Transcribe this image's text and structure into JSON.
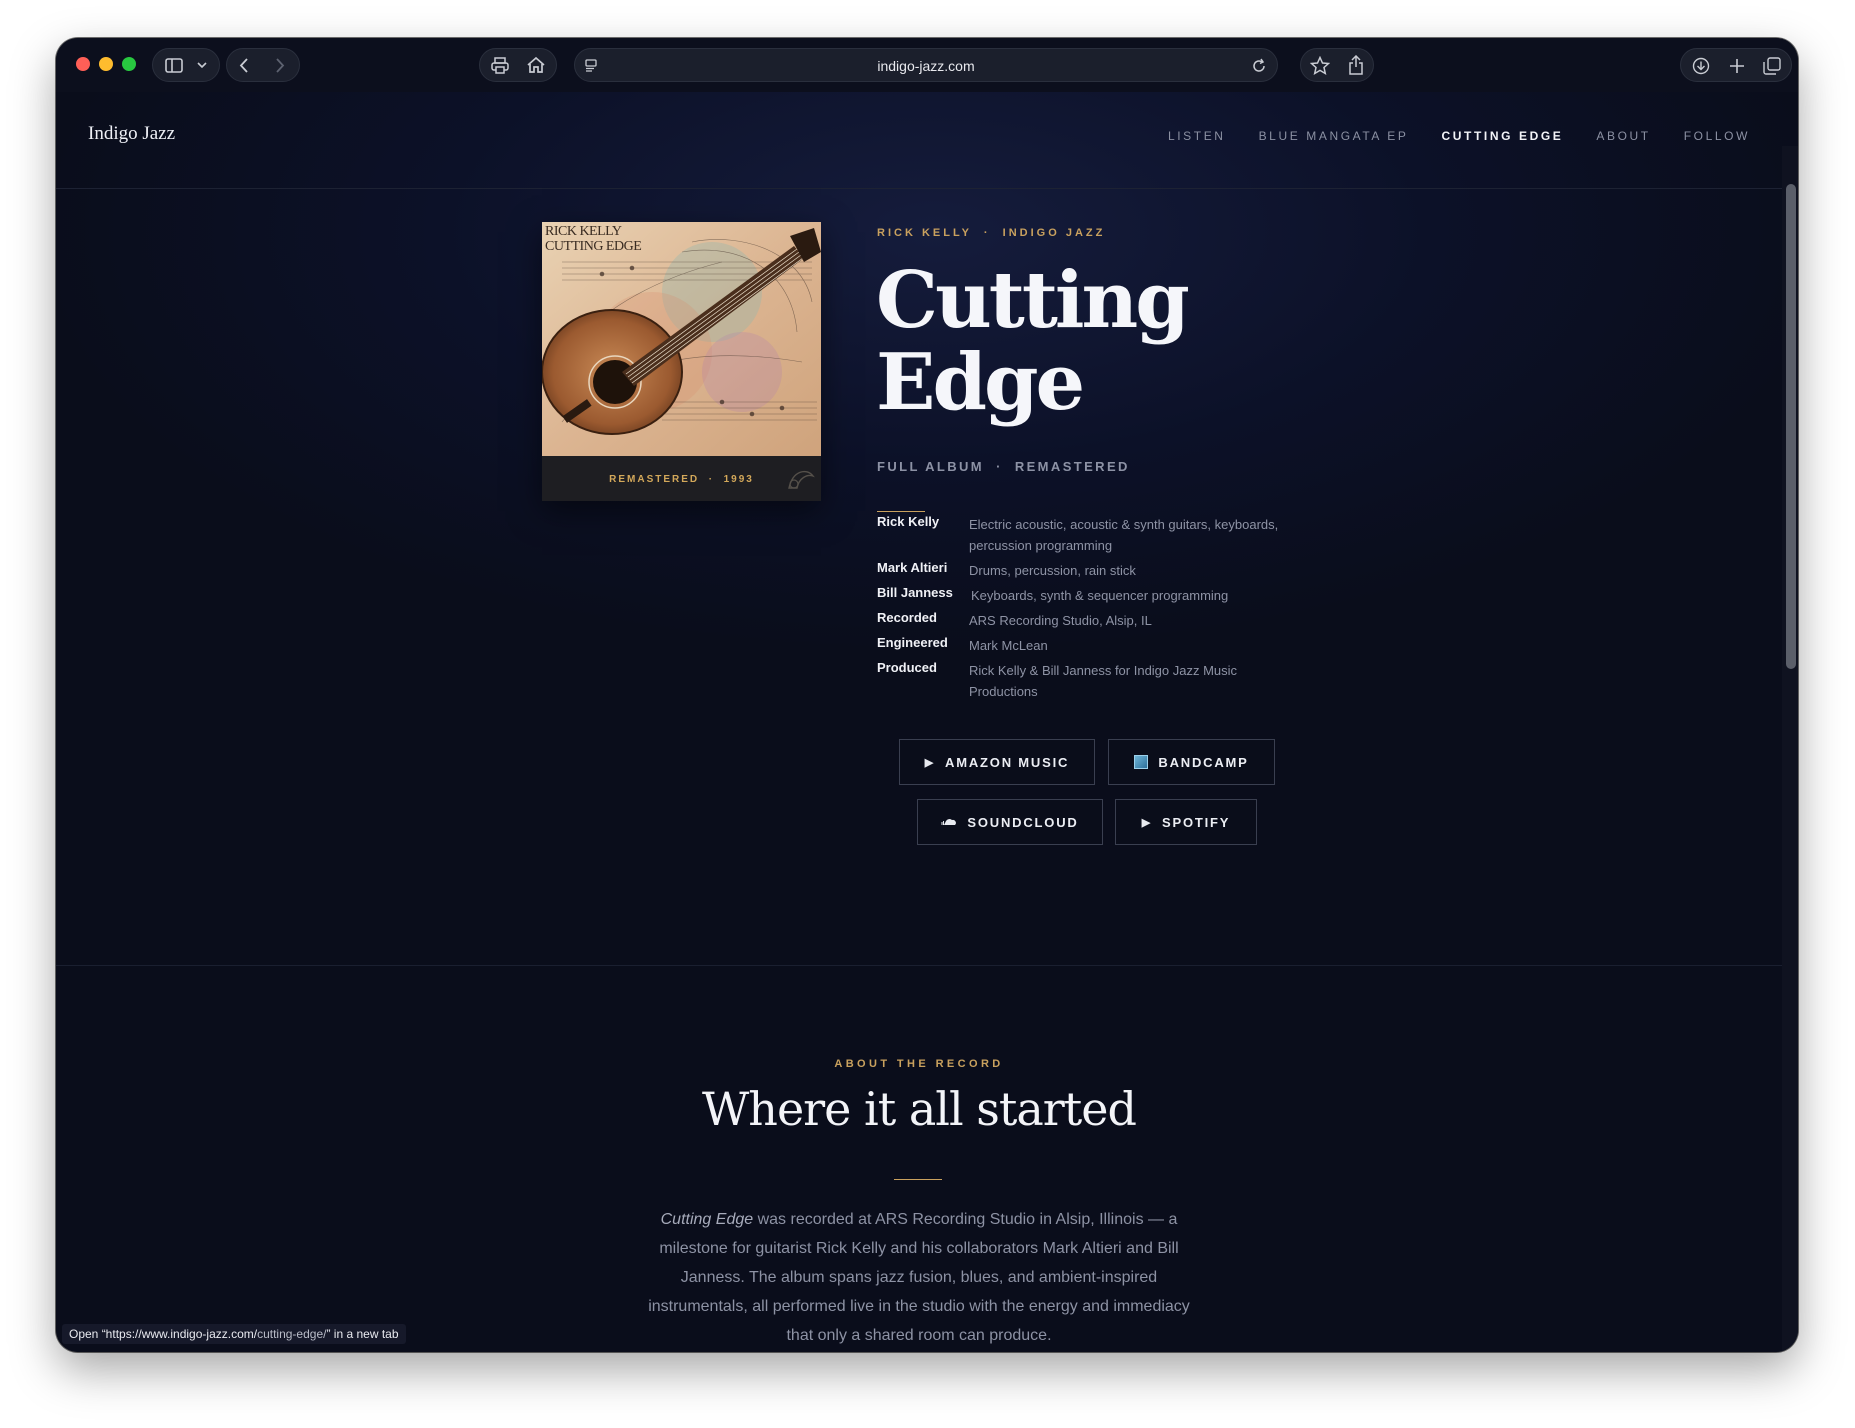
{
  "browser": {
    "url": "indigo-jazz.com",
    "status_prefix": "Open “https://www.indigo-jazz.com/",
    "status_path": "cutting-edge/",
    "status_suffix": "” in a new tab"
  },
  "site": {
    "brand": "Indigo Jazz",
    "nav": [
      "LISTEN",
      "BLUE MANGATA EP",
      "CUTTING EDGE",
      "ABOUT",
      "FOLLOW"
    ],
    "active_nav": "CUTTING EDGE"
  },
  "hero": {
    "cover_title_line1": "RICK KELLY",
    "cover_title_line2": "CUTTING EDGE",
    "cover_caption": "REMASTERED  ·  1993",
    "eyebrow": "RICK KELLY  ·  INDIGO JAZZ",
    "title_line1": "Cutting",
    "title_line2": "Edge",
    "subtitle": "FULL ALBUM  ·  REMASTERED",
    "credits": [
      {
        "who": "Rick Kelly",
        "what": "Electric acoustic, acoustic & synth guitars, keyboards, percussion programming"
      },
      {
        "who": "Mark Altieri",
        "what": "Drums, percussion, rain stick"
      },
      {
        "who": "Bill Janness",
        "what": "Keyboards, synth & sequencer programming"
      },
      {
        "who": "Recorded",
        "what": "ARS Recording Studio, Alsip, IL"
      },
      {
        "who": "Engineered",
        "what": "Mark McLean"
      },
      {
        "who": "Produced",
        "what": "Rick Kelly & Bill Janness for Indigo Jazz Music Productions"
      }
    ],
    "buttons": {
      "amazon": "AMAZON MUSIC",
      "bandcamp": "BANDCAMP",
      "soundcloud": "SOUNDCLOUD",
      "spotify": "SPOTIFY"
    }
  },
  "about": {
    "eyebrow": "ABOUT THE RECORD",
    "title": "Where it all started",
    "body_em": "Cutting Edge",
    "body_rest": " was recorded at ARS Recording Studio in Alsip, Illinois — a milestone for guitarist Rick Kelly and his collaborators Mark Altieri and Bill Janness. The album spans jazz fusion, blues, and ambient-inspired instrumentals, all performed live in the studio with the energy and immediacy that only a shared room can produce."
  },
  "colors": {
    "accent": "#c9a15e",
    "background": "#0a0d1b"
  }
}
